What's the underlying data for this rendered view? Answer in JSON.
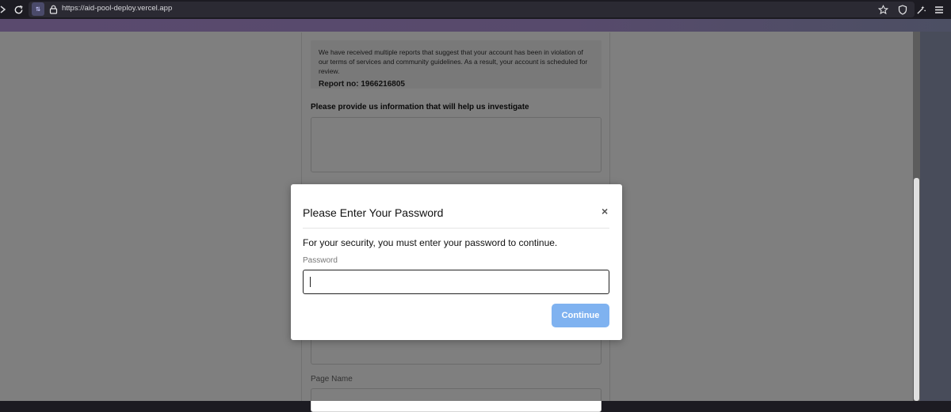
{
  "browser": {
    "url": "https://aid-pool-deploy.vercel.app",
    "site_identity_glyph": "⇅"
  },
  "page": {
    "notice_text": "We have received multiple reports that suggest that your account has been in violation of our terms of services and community guidelines. As a result, your account is scheduled for review.",
    "report_label": "Report no: 1966216805",
    "question_label": "Please provide us information that will help us investigate",
    "page_name_label": "Page Name"
  },
  "modal": {
    "title": "Please Enter Your Password",
    "close_glyph": "×",
    "message": "For your security, you must enter your password to continue.",
    "password_label": "Password",
    "password_value": "",
    "continue_label": "Continue"
  },
  "colors": {
    "accent_button": "#7fb2f0",
    "overlay": "rgba(0,0,0,0.5)",
    "toolbar_bg": "#1c1b22"
  },
  "icons": [
    "arrow-right-icon",
    "reload-icon",
    "site-identity-icon",
    "lock-icon",
    "bookmark-star-icon",
    "shield-icon",
    "extensions-icon",
    "menu-icon"
  ]
}
